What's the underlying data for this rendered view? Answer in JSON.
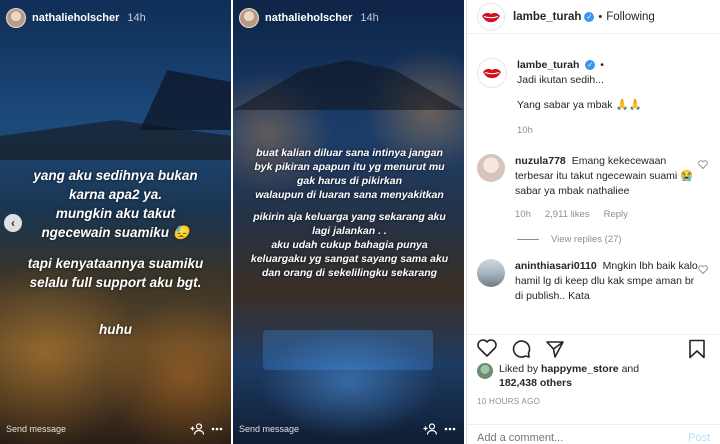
{
  "story1": {
    "username": "nathalieholscher",
    "time": "14h",
    "text_block_1": [
      "yang aku sedihnya bukan",
      "karna apa2 ya.",
      "mungkin aku takut",
      "ngecewain suamiku 😓"
    ],
    "text_block_2": [
      "tapi kenyataannya suamiku",
      "selalu full support aku bgt."
    ],
    "text_block_3": "huhu",
    "send_message": "Send message",
    "prev_arrow": "‹"
  },
  "story2": {
    "username": "nathalieholscher",
    "time": "14h",
    "text_block_1": [
      "buat kalian diluar sana intinya jangan",
      "byk pikiran apapun itu yg menurut mu",
      "gak harus di pikirkan",
      "walaupun di luaran sana menyakitkan"
    ],
    "text_block_2": [
      "pikirin aja keluarga yang sekarang aku",
      "lagi jalankan . .",
      "aku udah cukup bahagia punya",
      "keluargaku yg sangat sayang sama aku",
      "dan orang di sekelilingku sekarang"
    ],
    "send_message": "Send message"
  },
  "post": {
    "header": {
      "username": "lambe_turah",
      "separator": "•",
      "follow_status": "Following"
    },
    "caption": {
      "username": "lambe_turah",
      "lines": [
        "Jadi ikutan sedih...",
        "",
        "Yang sabar ya mbak 🙏🙏"
      ],
      "time": "10h"
    },
    "comments": [
      {
        "username": "nuzula778",
        "text": "Emang kekecewaan terbesar itu takut ngecewain suami 😭 sabar ya mbak nathaliee",
        "time": "10h",
        "likes": "2,911 likes",
        "reply_label": "Reply",
        "view_replies": "View replies (27)"
      },
      {
        "username": "aninthiasari0110",
        "text": "Mngkin lbh baik kalo hamil lg di keep dlu kak smpe aman br di publish.. Kata"
      }
    ],
    "liked_by": {
      "prefix": "Liked by",
      "user": "happyme_store",
      "connector": "and",
      "count": "182,438 others"
    },
    "timestamp": "10 HOURS AGO",
    "add_comment_placeholder": "Add a comment...",
    "post_button": "Post"
  },
  "icons": {
    "verified": "✓",
    "add_user": "+👤",
    "share": "⋯"
  },
  "colors": {
    "link_blue": "#3897f0",
    "post_disabled": "#b2dffc",
    "muted": "#8e8e8e",
    "text": "#262626"
  }
}
